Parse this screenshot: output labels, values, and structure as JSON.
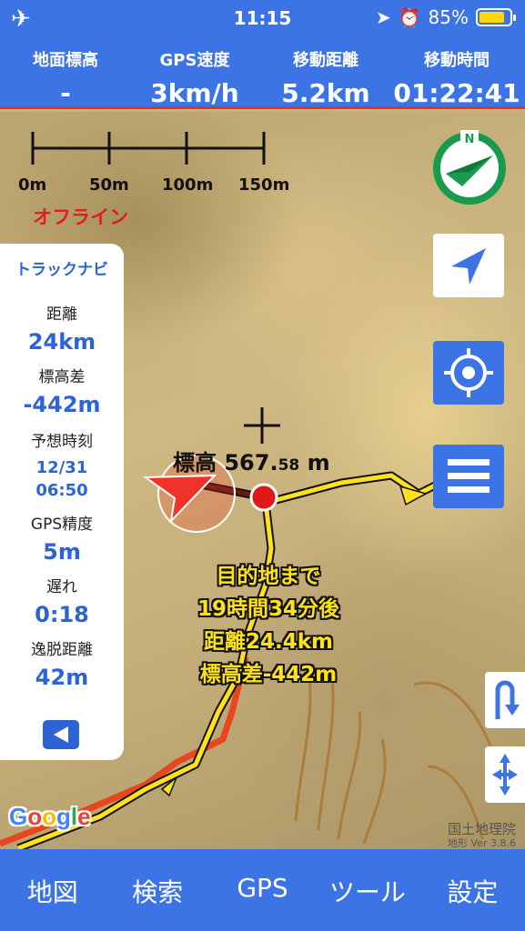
{
  "status_bar": {
    "time": "11:15",
    "battery": "85%",
    "battery_level": 0.85,
    "icons": [
      "airplane-icon",
      "location-arrow-icon",
      "alarm-icon",
      "battery-icon"
    ]
  },
  "info": {
    "elevation_label": "地面標高",
    "elevation_value": "-",
    "speed_label": "GPS速度",
    "speed_value": "3km/h",
    "distance_label": "移動距離",
    "distance_value": "5.2km",
    "time_label": "移動時間",
    "time_value": "01:22:41"
  },
  "map": {
    "scale_labels": [
      "0m",
      "50m",
      "100m",
      "150m"
    ],
    "offline": "オフライン",
    "elevation_label": "標高",
    "elevation_int": "567.",
    "elevation_dec": "58",
    "elevation_unit": "m",
    "dest_lines": [
      "目的地まで",
      "19時間34分後",
      "距離24.4km",
      "標高差-442m"
    ],
    "google_logo": "Google",
    "credit_line": "国土地理院",
    "credit_version": "地形 Ver 3.8.6"
  },
  "navi": {
    "title": "トラックナビ",
    "distance_label": "距離",
    "distance_value": "24km",
    "elev_diff_label": "標高差",
    "elev_diff_value": "-442m",
    "eta_label": "予想時刻",
    "eta_date": "12/31",
    "eta_time": "06:50",
    "gps_accuracy_label": "GPS精度",
    "gps_accuracy_value": "5m",
    "delay_label": "遅れ",
    "delay_value": "0:18",
    "deviation_label": "逸脱距離",
    "deviation_value": "42m"
  },
  "tabs": [
    "地図",
    "検索",
    "GPS",
    "ツール",
    "設定"
  ],
  "colors": {
    "accent": "#3c74e6",
    "navi_text": "#2d63d6",
    "offline": "#e0201b",
    "route": "#ffe21a"
  }
}
